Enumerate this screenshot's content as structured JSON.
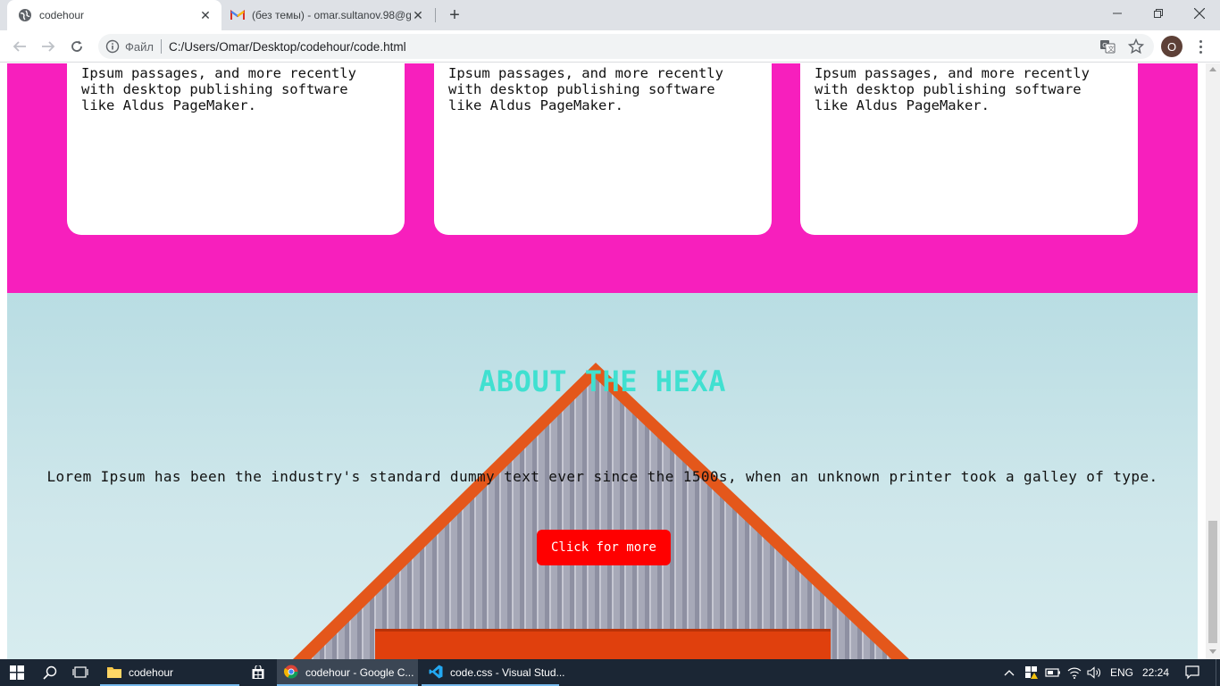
{
  "browser": {
    "tabs": [
      {
        "title": "codehour",
        "icon": "globe-icon",
        "active": true
      },
      {
        "title": "(без темы) - omar.sultanov.98@g",
        "icon": "gmail-icon",
        "active": false
      }
    ],
    "address": {
      "scheme_label": "Файл",
      "url": "C:/Users/Omar/Desktop/codehour/code.html"
    },
    "profile_initial": "O"
  },
  "page": {
    "cards": [
      {
        "text": "Ipsum passages, and more recently\nwith desktop publishing software\nlike Aldus PageMaker."
      },
      {
        "text": "Ipsum passages, and more recently\nwith desktop publishing software\nlike Aldus PageMaker."
      },
      {
        "text": "Ipsum passages, and more recently\nwith desktop publishing software\nlike Aldus PageMaker."
      }
    ],
    "about": {
      "title": "ABOUT THE HEXA",
      "text": "Lorem Ipsum has been the industry's standard dummy text ever since the 1500s, when an unknown printer took a galley of type.",
      "button": "Click for more"
    },
    "colors": {
      "pink": "#f71fbd",
      "title": "#40e0d0",
      "button": "#ff0000"
    }
  },
  "taskbar": {
    "apps": [
      {
        "label": "codehour",
        "icon": "folder-icon"
      },
      {
        "label": "",
        "icon": "store-icon"
      },
      {
        "label": "codehour - Google C...",
        "icon": "chrome-icon"
      },
      {
        "label": "code.css - Visual Stud...",
        "icon": "vscode-icon"
      }
    ],
    "language": "ENG",
    "time": "22:24"
  }
}
